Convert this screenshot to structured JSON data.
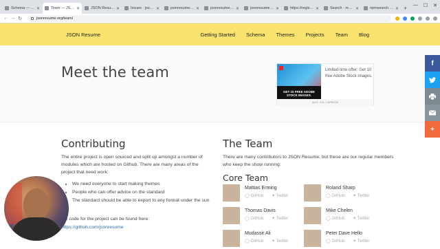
{
  "browser": {
    "tabs": [
      {
        "label": "Schema — JSON Resume",
        "active": false
      },
      {
        "label": "Team — JSON Resume",
        "active": true
      },
      {
        "label": "JSON Resume",
        "active": false
      },
      {
        "label": "Issues · jsonresume",
        "active": false
      },
      {
        "label": "jsonresume/resume",
        "active": false
      },
      {
        "label": "jsonresume-theme",
        "active": false
      },
      {
        "label": "jsonresume/registry",
        "active": false
      },
      {
        "label": "https://registry.jso",
        "active": false
      },
      {
        "label": "Search · resume.js",
        "active": false
      },
      {
        "label": "npmsearch · node",
        "active": false
      }
    ],
    "url": "jsonresume.org/team/"
  },
  "site": {
    "brand": "JSON Resume",
    "nav": [
      "Getting Started",
      "Schema",
      "Themes",
      "Projects",
      "Team",
      "Blog"
    ]
  },
  "hero": {
    "title": "Meet the team",
    "ad": {
      "image_text": "GET 10 FREE ADOBE STOCK IMAGES.",
      "text": "Limited time offer: Get 10 free Adobe Stock images.",
      "footer": "ADS VIA CARBON"
    }
  },
  "contributing": {
    "title": "Contributing",
    "intro": "The entire project is open sourced and split up amongst a number of modules which are hosted on Github. There are many areas of the project that need work:",
    "bullets": [
      "We need everyone to start making themes",
      "People who can offer advice on the standard",
      "The standard should be able to export to any format under the sun"
    ],
    "code_prefix": "the code for the project can be found here:",
    "code_link": "https://github.com/jsonresume"
  },
  "team": {
    "title": "The Team",
    "intro": "There are many contributors to JSON Resume, but these are our regular members who keep the show running:",
    "core_title": "Core Team",
    "link_github": "GitHub",
    "link_twitter": "Twitter",
    "members": [
      {
        "name": "Mattias Erming"
      },
      {
        "name": "Roland Sharp"
      },
      {
        "name": "Thomas Davis"
      },
      {
        "name": "Mike Chelen"
      },
      {
        "name": "Mudassir Ali"
      },
      {
        "name": "Peter Dave Hello"
      }
    ]
  },
  "social": [
    "facebook-icon",
    "twitter-icon",
    "print-icon",
    "email-icon",
    "plus-icon"
  ]
}
